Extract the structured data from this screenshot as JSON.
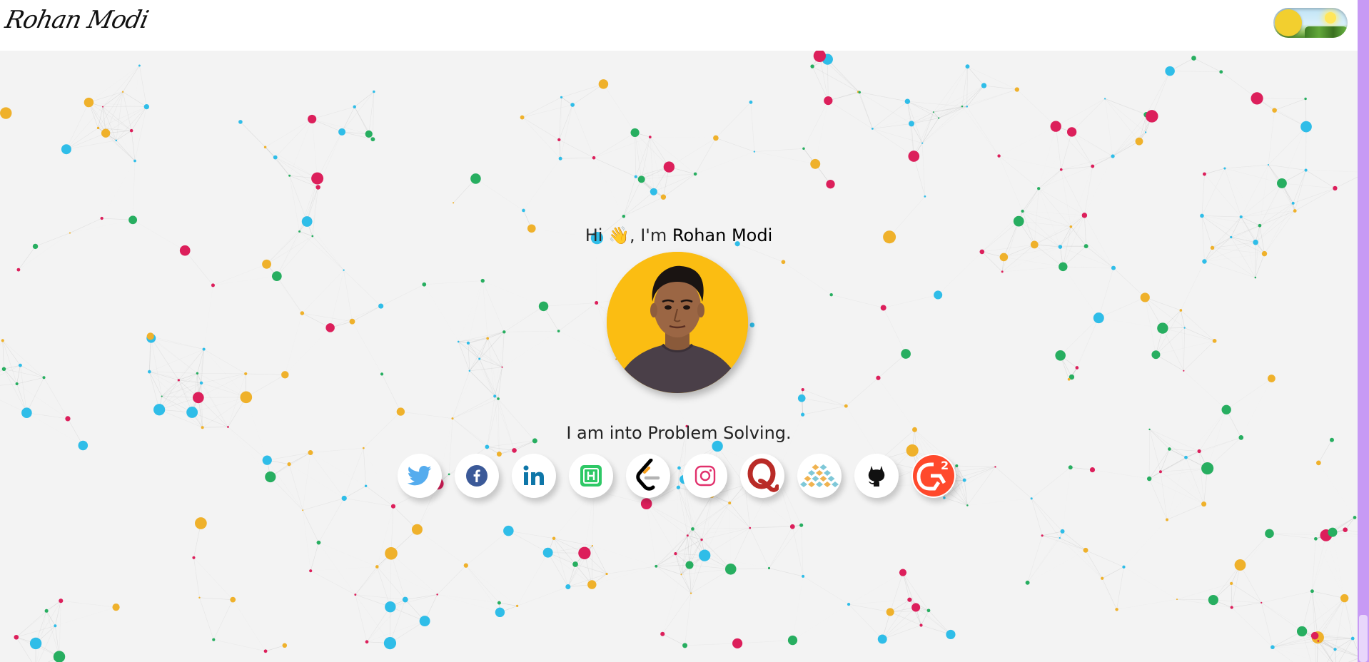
{
  "header": {
    "logo_text": "Rohan Modi",
    "theme_toggle_icon": "sun-day-toggle-icon"
  },
  "hero": {
    "greeting_prefix": "Hi ",
    "wave_emoji": "👋",
    "greeting_middle": ", I'm ",
    "name": "Rohan Modi",
    "avatar_icon": "profile-photo",
    "tagline": "I am into Problem Solving."
  },
  "social_links": [
    {
      "name": "twitter",
      "icon": "twitter-icon",
      "color": "#55acee"
    },
    {
      "name": "facebook",
      "icon": "facebook-icon",
      "color": "#3b5998"
    },
    {
      "name": "linkedin",
      "icon": "linkedin-icon",
      "color": "#0e76a8"
    },
    {
      "name": "hackerrank",
      "icon": "hackerrank-icon",
      "color": "#2ec866"
    },
    {
      "name": "leetcode",
      "icon": "leetcode-icon",
      "color": "#f89f1b"
    },
    {
      "name": "instagram",
      "icon": "instagram-icon",
      "color": "#e1306c"
    },
    {
      "name": "quora",
      "icon": "quora-icon",
      "color": "#b92b27"
    },
    {
      "name": "codechef",
      "icon": "codechef-icon",
      "color": "#f0b350"
    },
    {
      "name": "github",
      "icon": "github-icon",
      "color": "#111111"
    },
    {
      "name": "g2",
      "icon": "g2-icon",
      "color": "#ff492c"
    }
  ],
  "colors": {
    "background": "#f3f3f3",
    "node_green": "#27ae60",
    "node_blue": "#2fbde8",
    "node_yellow": "#efb12b",
    "node_red": "#dc1f5b",
    "avatar_bg": "#fbbd12",
    "scrollbar": "#c79af5"
  }
}
